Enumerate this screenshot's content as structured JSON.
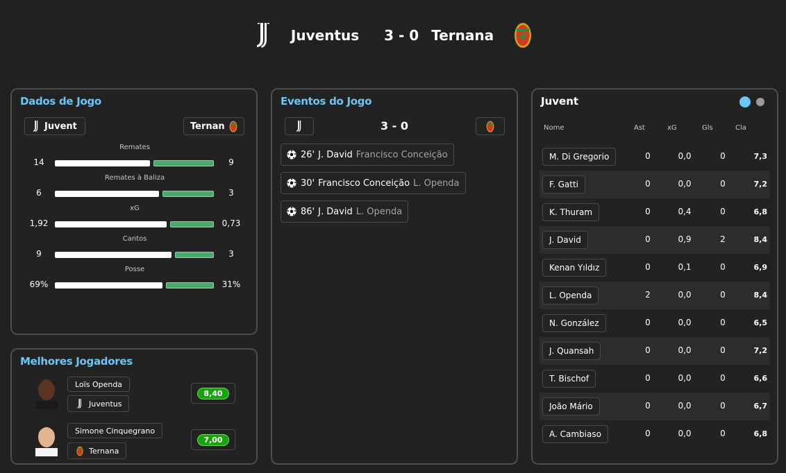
{
  "header": {
    "home_team": "Juventus",
    "score": "3 - 0",
    "away_team": "Ternana"
  },
  "match_stats": {
    "title": "Dados de Jogo",
    "home_short": "Juvent",
    "away_short": "Ternan",
    "stats": [
      {
        "label": "Remates",
        "home": "14",
        "away": "9",
        "home_share": 0.61
      },
      {
        "label": "Remates à Baliza",
        "home": "6",
        "away": "3",
        "home_share": 0.67
      },
      {
        "label": "xG",
        "home": "1,92",
        "away": "0,73",
        "home_share": 0.72
      },
      {
        "label": "Cantos",
        "home": "9",
        "away": "3",
        "home_share": 0.75
      },
      {
        "label": "Posse",
        "home": "69%",
        "away": "31%",
        "home_share": 0.69
      }
    ]
  },
  "events": {
    "title": "Eventos do Jogo",
    "score": "3 - 0",
    "items": [
      {
        "minute": "26'",
        "scorer": "J. David",
        "assist": "Francisco Conceição"
      },
      {
        "minute": "30'",
        "scorer": "Francisco Conceição",
        "assist": "L. Openda"
      },
      {
        "minute": "86'",
        "scorer": "J. David",
        "assist": "L. Openda"
      }
    ]
  },
  "best_players": {
    "title": "Melhores Jogadores",
    "players": [
      {
        "name": "Loïs Openda",
        "team": "Juventus",
        "rating": "8,40"
      },
      {
        "name": "Simone Cinquegrano",
        "team": "Ternana",
        "rating": "7,00"
      }
    ]
  },
  "lineup": {
    "team": "Juvent",
    "columns": {
      "name": "Nome",
      "ast": "Ast",
      "xg": "xG",
      "gls": "Gls",
      "cla": "Cla"
    },
    "players": [
      {
        "name": "M. Di Gregorio",
        "ast": "0",
        "xg": "0,0",
        "gls": "0",
        "cla": "7,3"
      },
      {
        "name": "F. Gatti",
        "ast": "0",
        "xg": "0,0",
        "gls": "0",
        "cla": "7,2"
      },
      {
        "name": "K. Thuram",
        "ast": "0",
        "xg": "0,4",
        "gls": "0",
        "cla": "6,8"
      },
      {
        "name": "J. David",
        "ast": "0",
        "xg": "0,9",
        "gls": "2",
        "cla": "8,4"
      },
      {
        "name": "Kenan Yıldız",
        "ast": "0",
        "xg": "0,1",
        "gls": "0",
        "cla": "6,9"
      },
      {
        "name": "L. Openda",
        "ast": "2",
        "xg": "0,0",
        "gls": "0",
        "cla": "8,4"
      },
      {
        "name": "N. González",
        "ast": "0",
        "xg": "0,0",
        "gls": "0",
        "cla": "6,5"
      },
      {
        "name": "J. Quansah",
        "ast": "0",
        "xg": "0,0",
        "gls": "0",
        "cla": "7,2"
      },
      {
        "name": "T. Bischof",
        "ast": "0",
        "xg": "0,0",
        "gls": "0",
        "cla": "6,6"
      },
      {
        "name": "João Mário",
        "ast": "0",
        "xg": "0,0",
        "gls": "0",
        "cla": "6,7"
      },
      {
        "name": "A. Cambiaso",
        "ast": "0",
        "xg": "0,0",
        "gls": "0",
        "cla": "6,8"
      }
    ]
  },
  "colors": {
    "accent": "#6cc6f5",
    "bar_away": "#4ea76d",
    "rating_green": "#17a40d"
  }
}
